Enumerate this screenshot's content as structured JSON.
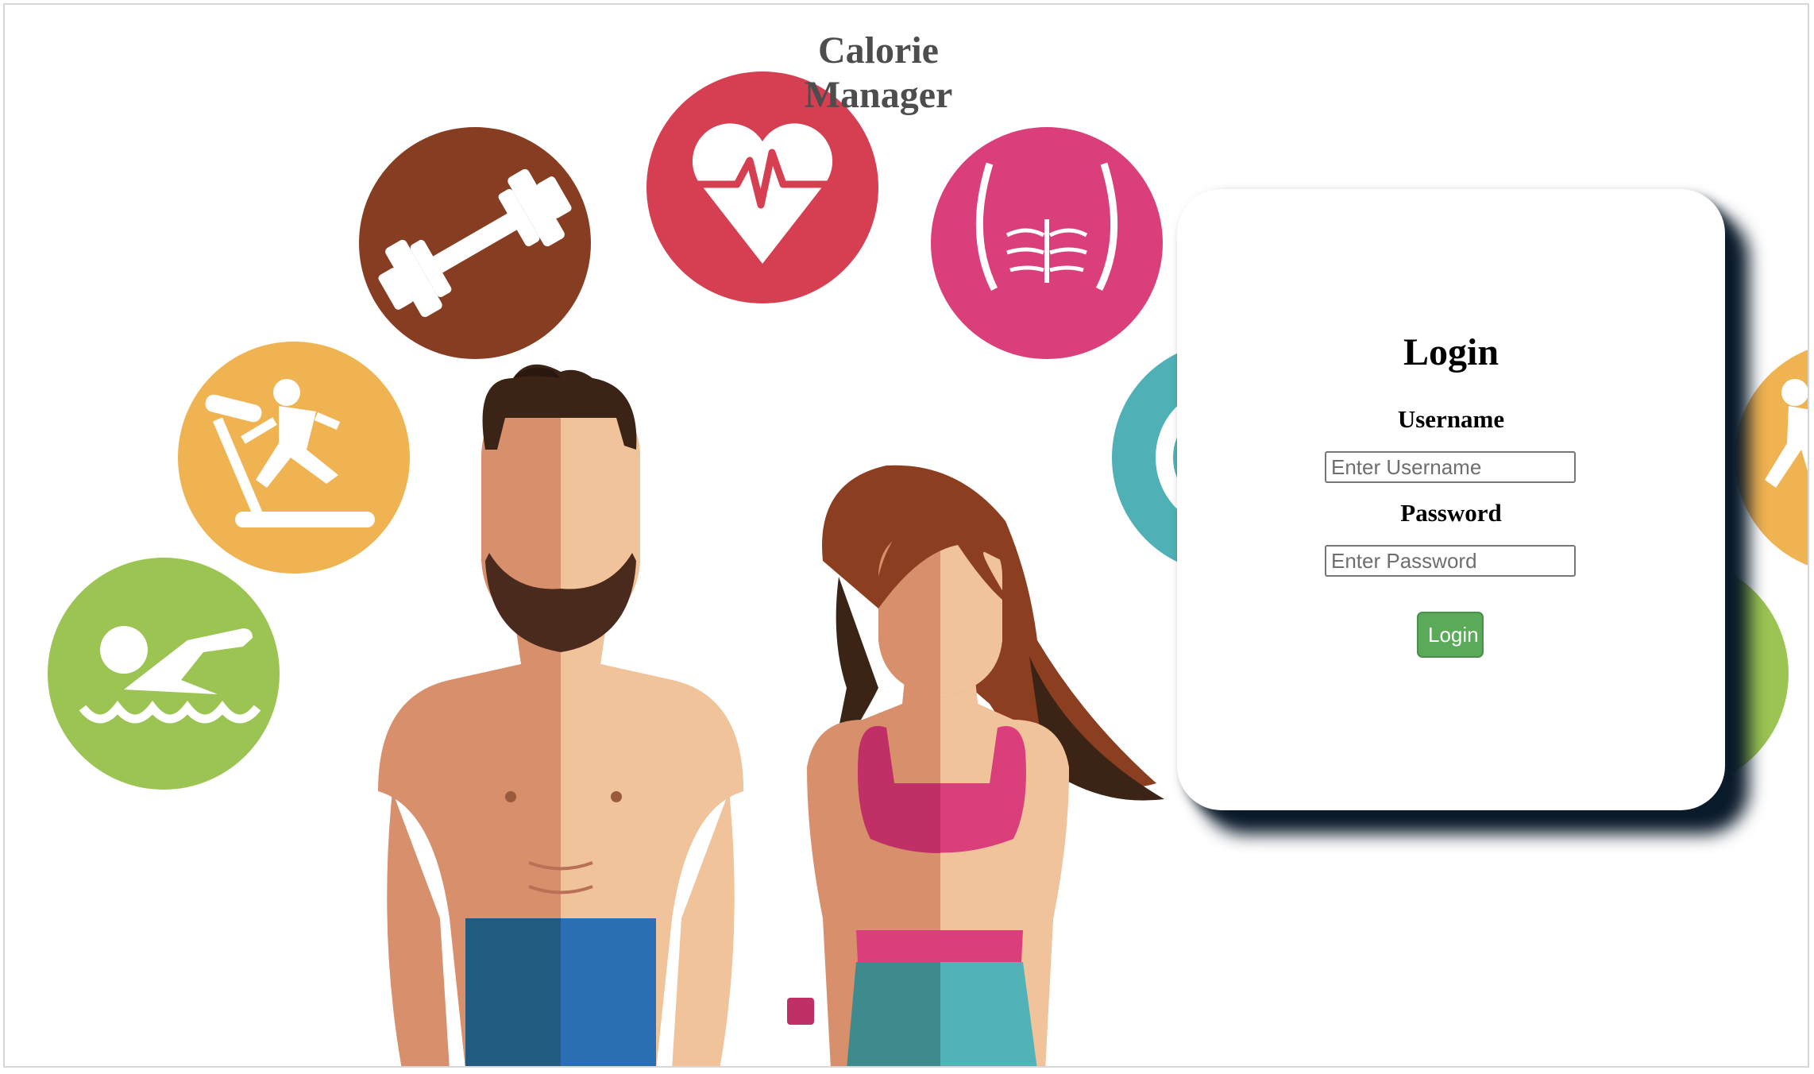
{
  "app": {
    "title": "Calorie Manager"
  },
  "login": {
    "heading": "Login",
    "username_label": "Username",
    "username_placeholder": "Enter Username",
    "password_label": "Password",
    "password_placeholder": "Enter Password",
    "button_label": "Login"
  },
  "icons": [
    "swimming-icon",
    "treadmill-icon",
    "dumbbell-icon",
    "heart-rate-icon",
    "abs-icon",
    "stopwatch-icon",
    "fitness-man",
    "fitness-woman"
  ],
  "colors": {
    "title_text": "#4d4d4d",
    "login_button": "#5aaa5a",
    "card_shadow": "#0a1a2a",
    "swim_circle": "#9bc452",
    "treadmill_circle": "#f0b352",
    "dumbbell_circle": "#873d21",
    "heart_circle": "#d63f52",
    "abs_circle": "#db3f7b",
    "stopwatch_circle": "#4fb1b5"
  }
}
